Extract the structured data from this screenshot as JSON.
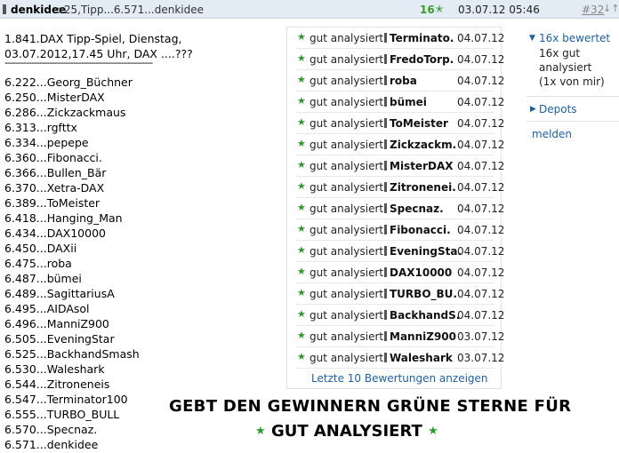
{
  "header": {
    "author": "denkidee",
    "subject": ": 25,Tipp...6.571...denkidee",
    "score": "16",
    "datetime": "03.07.12 05:46",
    "post_number": "#32",
    "arrows": "↓↑"
  },
  "post": {
    "line1": "1.841.DAX Tipp-Spiel, Dienstag,",
    "line2": "03.07.2012,17.45 Uhr, DAX ....???",
    "divider": "--------------------------------------------------------",
    "tips": [
      "6.222...Georg_Büchner",
      "6.250...MisterDAX",
      "6.286...Zickzackmaus",
      "6.313...rgfttx",
      "6.334...pepepe",
      "6.360...Fibonacci.",
      "6.366...Bullen_Bär",
      "6.370...Xetra-DAX",
      "6.389...ToMeister",
      "6.418...Hanging_Man",
      "6.434...DAX10000",
      "6.450...DAXii",
      "6.475...roba",
      "6.487...bümei",
      "6.489...SagittariusA",
      "6.495...AIDAsol",
      "6.496...ManniZ900",
      "6.505...EveningStar",
      "6.525...BackhandSmash",
      "6.530...Waleshark",
      "6.544...Zitroneneis",
      "6.547...Terminator100",
      "6.555...TURBO_BULL",
      "6.570...Specnaz.",
      "6.571...denkidee"
    ],
    "banner_line1": "GEBT DEN GEWINNERN GRÜNE STERNE FÜR",
    "banner_line2": "GUT ANALYSIERT"
  },
  "ratings": {
    "rows": [
      {
        "label": "gut analysiert",
        "user": "Terminato.",
        "date": "04.07.12"
      },
      {
        "label": "gut analysiert",
        "user": "FredoTorp.",
        "date": "04.07.12"
      },
      {
        "label": "gut analysiert",
        "user": "roba",
        "date": "04.07.12"
      },
      {
        "label": "gut analysiert",
        "user": "bümei",
        "date": "04.07.12"
      },
      {
        "label": "gut analysiert",
        "user": "ToMeister",
        "date": "04.07.12"
      },
      {
        "label": "gut analysiert",
        "user": "Zickzackm.",
        "date": "04.07.12"
      },
      {
        "label": "gut analysiert",
        "user": "MisterDAX",
        "date": "04.07.12"
      },
      {
        "label": "gut analysiert",
        "user": "Zitronenei.",
        "date": "04.07.12"
      },
      {
        "label": "gut analysiert",
        "user": "Specnaz.",
        "date": "04.07.12"
      },
      {
        "label": "gut analysiert",
        "user": "Fibonacci.",
        "date": "04.07.12"
      },
      {
        "label": "gut analysiert",
        "user": "EveningSta.",
        "date": "04.07.12"
      },
      {
        "label": "gut analysiert",
        "user": "DAX10000",
        "date": "04.07.12"
      },
      {
        "label": "gut analysiert",
        "user": "TURBO_BU.",
        "date": "04.07.12"
      },
      {
        "label": "gut analysiert",
        "user": "BackhandS.",
        "date": "04.07.12"
      },
      {
        "label": "gut analysiert",
        "user": "ManniZ900",
        "date": "03.07.12"
      },
      {
        "label": "gut analysiert",
        "user": "Waleshark",
        "date": "03.07.12"
      }
    ],
    "more_link": "Letzte 10 Bewertungen anzeigen"
  },
  "sidebar": {
    "rated_head": "16x bewertet",
    "rated_line1": "16x gut",
    "rated_line2": "analysiert",
    "rated_line3": "(1x von mir)",
    "depots": "Depots",
    "report": "melden"
  },
  "colors": {
    "accent_green": "#2e9a2e",
    "link_blue": "#1f5f9f",
    "header_bg": "#e3ebf4"
  },
  "icons": {
    "star": "star-icon",
    "expand": "triangle-down-icon",
    "collapse": "triangle-right-icon"
  }
}
